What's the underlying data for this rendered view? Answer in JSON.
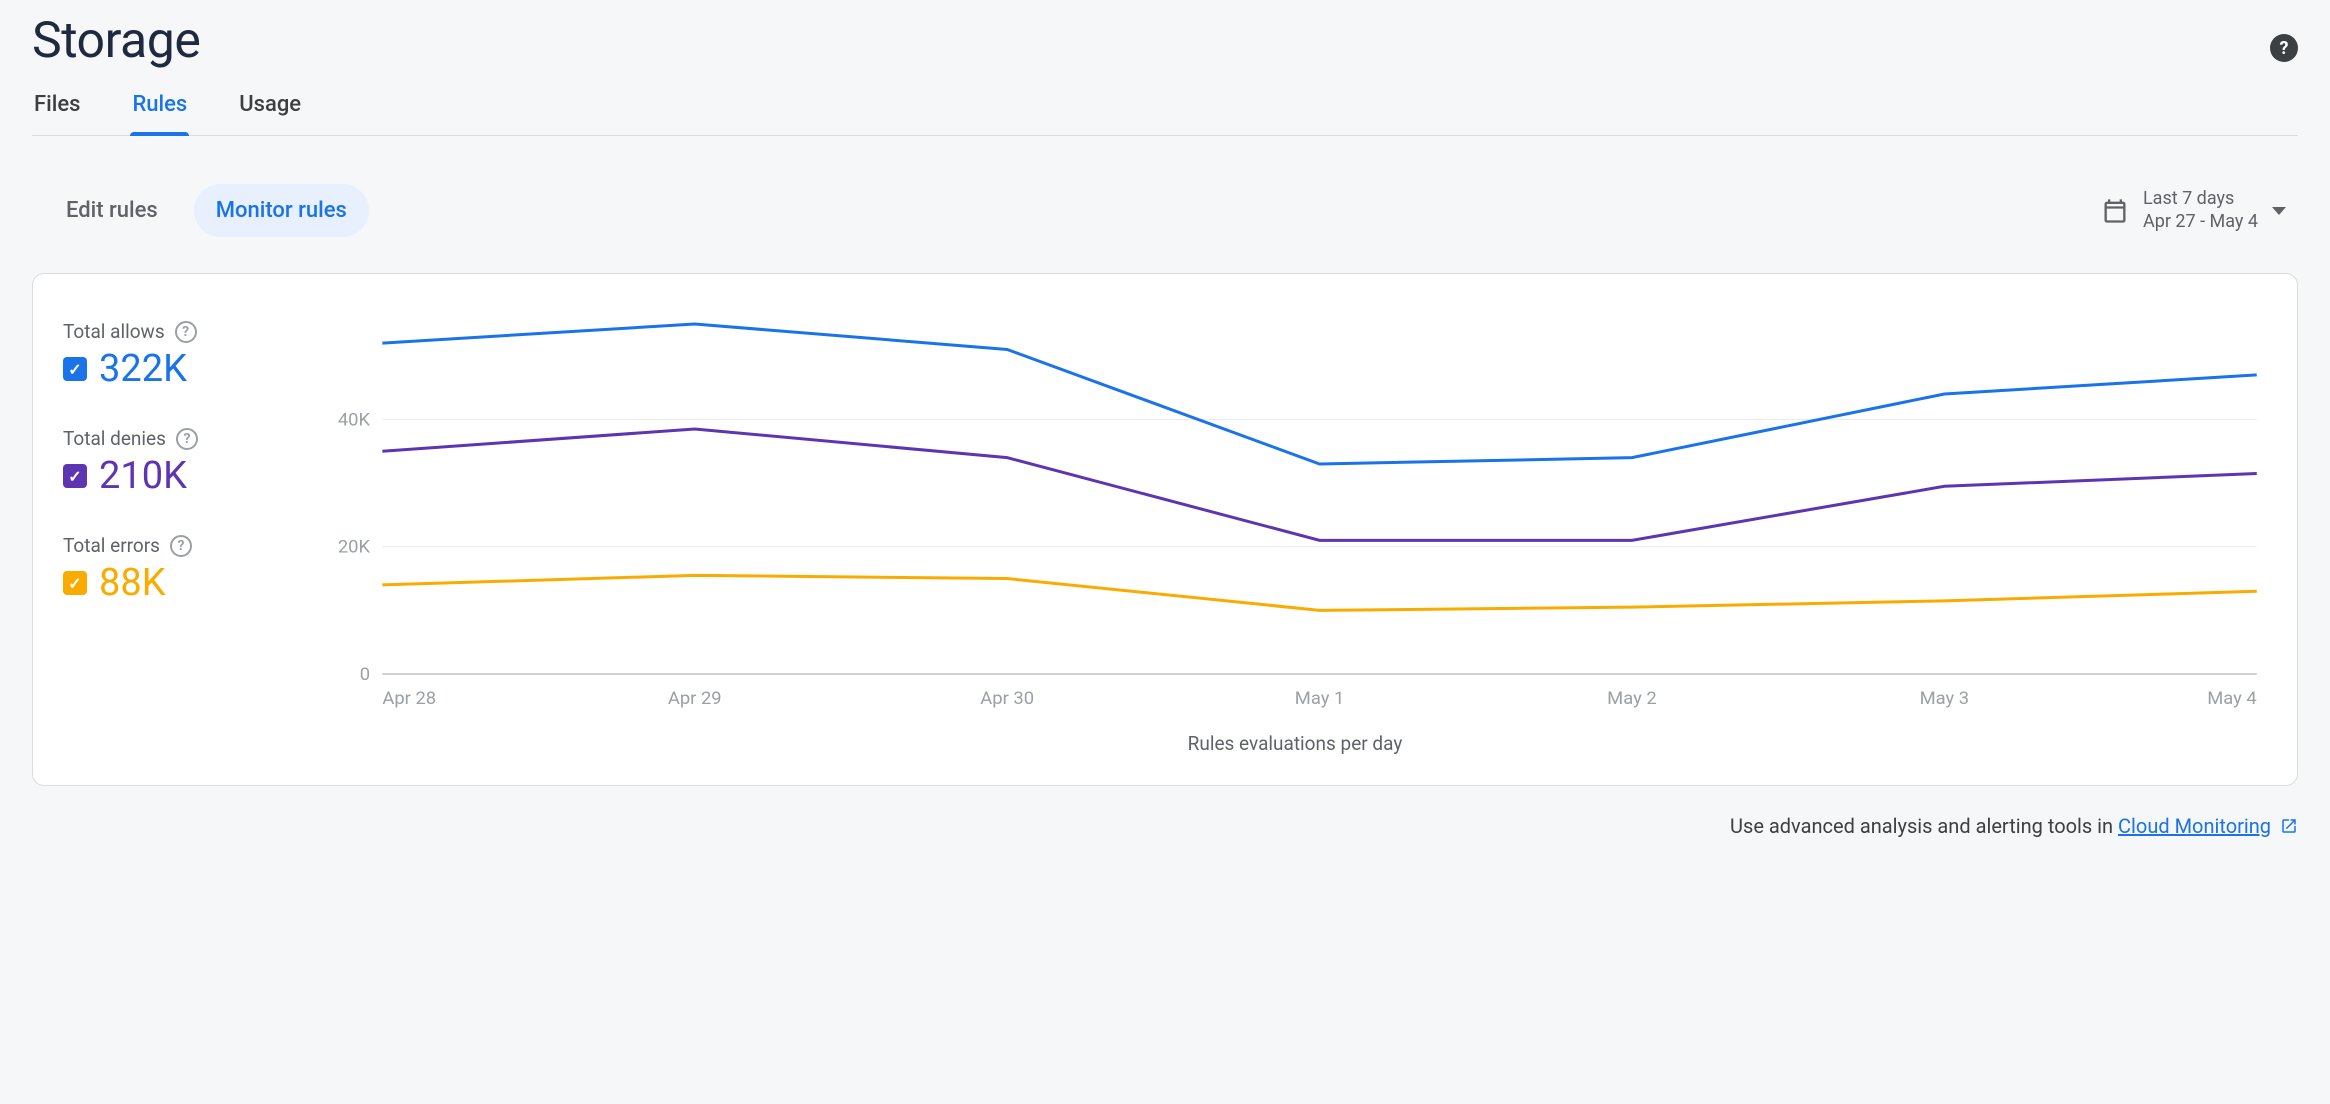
{
  "header": {
    "title": "Storage"
  },
  "tabs": [
    {
      "id": "files",
      "label": "Files",
      "active": false
    },
    {
      "id": "rules",
      "label": "Rules",
      "active": true
    },
    {
      "id": "usage",
      "label": "Usage",
      "active": false
    }
  ],
  "subtabs": [
    {
      "id": "edit",
      "label": "Edit rules",
      "active": false
    },
    {
      "id": "monitor",
      "label": "Monitor rules",
      "active": true
    }
  ],
  "date_picker": {
    "label": "Last 7 days",
    "range": "Apr 27 - May 4"
  },
  "legend": [
    {
      "id": "allows",
      "label": "Total allows",
      "value": "322K",
      "color": "#1a73e8"
    },
    {
      "id": "denies",
      "label": "Total denies",
      "value": "210K",
      "color": "#5e35b1"
    },
    {
      "id": "errors",
      "label": "Total errors",
      "value": "88K",
      "color": "#f9ab00"
    }
  ],
  "footer": {
    "prefix": "Use advanced analysis and alerting tools in ",
    "link_text": "Cloud Monitoring"
  },
  "chart_data": {
    "type": "line",
    "xlabel": "Rules evaluations per day",
    "ylabel": "",
    "categories": [
      "Apr 28",
      "Apr 29",
      "Apr 30",
      "May 1",
      "May 2",
      "May 3",
      "May 4"
    ],
    "y_ticks": [
      0,
      20000,
      40000
    ],
    "y_tick_labels": [
      "0",
      "20K",
      "40K"
    ],
    "ylim": [
      0,
      55000
    ],
    "series": [
      {
        "name": "Total allows",
        "color": "#1a73e8",
        "values": [
          52000,
          55000,
          51000,
          33000,
          34000,
          44000,
          47000
        ]
      },
      {
        "name": "Total denies",
        "color": "#5e35b1",
        "values": [
          35000,
          38500,
          34000,
          21000,
          21000,
          29500,
          31500
        ]
      },
      {
        "name": "Total errors",
        "color": "#f9ab00",
        "values": [
          14000,
          15500,
          15000,
          10000,
          10500,
          11500,
          13000
        ]
      }
    ]
  }
}
